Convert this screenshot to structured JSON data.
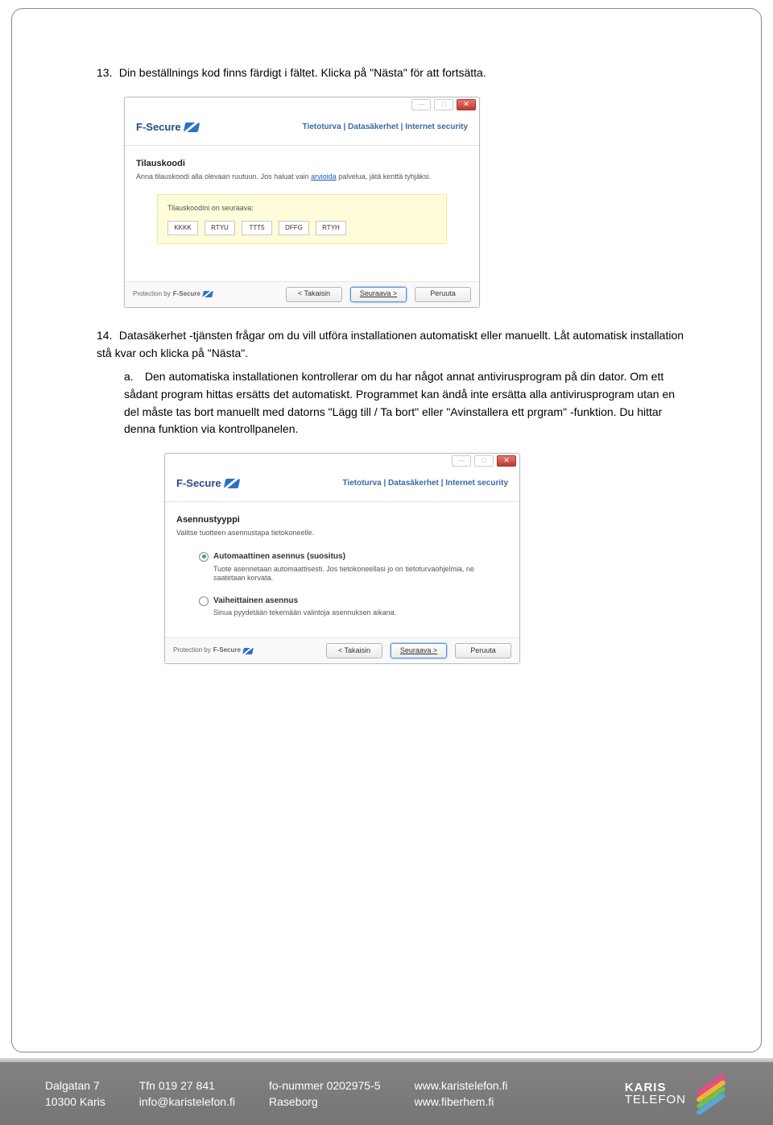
{
  "step13": {
    "number": "13.",
    "text": "Din beställnings kod finns färdigt i fältet. Klicka på \"Nästa\" för att fortsätta."
  },
  "step14": {
    "number": "14.",
    "text": "Datasäkerhet -tjänsten frågar om du vill utföra installationen automatiskt eller manuellt. Låt automatisk installation stå kvar och klicka på \"Nästa\".",
    "sub_a_num": "a.",
    "sub_a_text": "Den automatiska installationen kontrollerar om du har något annat antivirusprogram på din dator. Om ett sådant program hittas ersätts det automatiskt. Programmet kan ändå inte ersätta alla antivirusprogram utan en del måste tas bort manuellt med datorns \"Lägg till / Ta bort\" eller \"Avinstallera ett prgram\" -funktion. Du hittar denna funktion via kontrollpanelen."
  },
  "installer": {
    "brand": "F-Secure",
    "tagline": "Tietoturva | Datasäkerhet | Internet security",
    "protected_by": "Protection by",
    "back": "< Takaisin",
    "next": "Seuraava >",
    "cancel": "Peruuta"
  },
  "screen1": {
    "section": "Tilauskoodi",
    "desc_before": "Anna tilauskoodi alla olevaan ruutuun. Jos haluat vain ",
    "desc_link": "arvioida",
    "desc_after": " palvelua, jätä kenttä tyhjäksi.",
    "code_label": "Tilauskoodini on seuraava:",
    "codes": [
      "KKKK",
      "RTYU",
      "TTT5",
      "DFFG",
      "RTYH"
    ]
  },
  "screen2": {
    "section": "Asennustyyppi",
    "desc": "Valitse tuotteen asennustapa tietokoneelle.",
    "opt1_title": "Automaattinen asennus (suositus)",
    "opt1_desc": "Tuote asennetaan automaattisesti. Jos tietokoneellasi jo on tietoturvaohjelmia, ne saatetaan korvata.",
    "opt2_title": "Vaiheittainen asennus",
    "opt2_desc": "Sinua pyydetään tekemään valintoja asennuksen aikana."
  },
  "footer": {
    "col1a": "Dalgatan 7",
    "col1b": "10300 Karis",
    "col2a": "Tfn 019 27 841",
    "col2b": "info@karistelefon.fi",
    "col3a": "fo-nummer 0202975-5",
    "col3b": "Raseborg",
    "col4a": "www.karistelefon.fi",
    "col4b": "www.fiberhem.fi",
    "brand1": "KARIS",
    "brand2": "TELEFON"
  }
}
